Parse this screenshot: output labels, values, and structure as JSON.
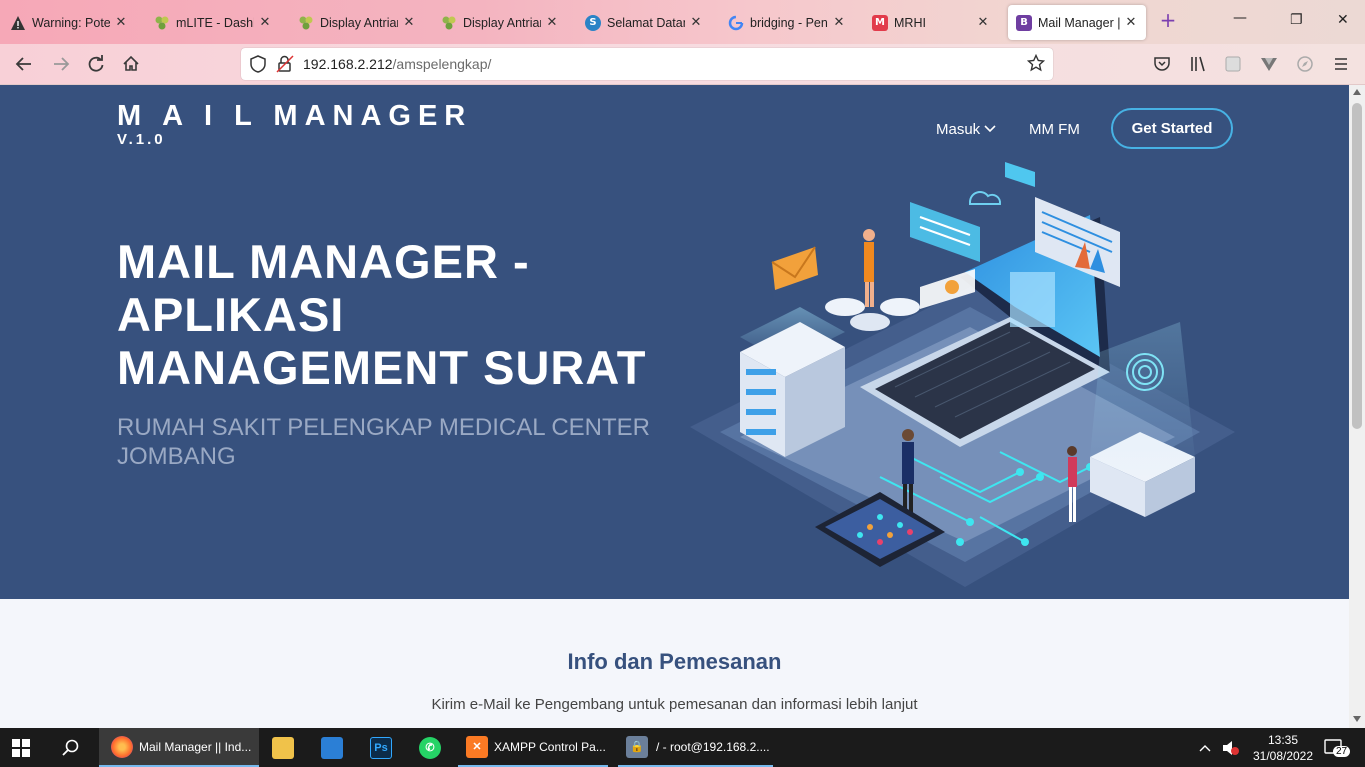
{
  "browser": {
    "tabs": [
      {
        "title": "Warning: Potent",
        "icon": "warning-icon"
      },
      {
        "title": "mLITE - Dashbo",
        "icon": "mlite-icon"
      },
      {
        "title": "Display Antrian |",
        "icon": "mlite-icon"
      },
      {
        "title": "Display Antrian |",
        "icon": "mlite-icon"
      },
      {
        "title": "Selamat Datang",
        "icon": "s-icon"
      },
      {
        "title": "bridging - Penel",
        "icon": "google-icon"
      },
      {
        "title": "MRHI",
        "icon": "mrhi-icon"
      },
      {
        "title": "Mail Manager ||",
        "icon": "bootstrap-icon"
      }
    ],
    "url_host": "192.168.2.212",
    "url_path": "/amspelengkap/"
  },
  "site": {
    "brand": "M A I L MANAGER",
    "version": "V.1.0",
    "nav": {
      "masuk": "Masuk",
      "mmfm": "MM FM",
      "get_started": "Get Started"
    },
    "hero_title": "MAIL MANAGER - APLIKASI MANAGEMENT SURAT",
    "hero_subtitle": "RUMAH SAKIT PELENGKAP MEDICAL CENTER JOMBANG",
    "section_title": "Info dan Pemesanan",
    "section_text": "Kirim e-Mail ke Pengembang untuk pemesanan dan informasi lebih lanjut"
  },
  "taskbar": {
    "items": [
      {
        "label": "Mail Manager || Ind...",
        "icon": "firefox-icon"
      },
      {
        "label": "XAMPP Control Pa...",
        "icon": "xampp-icon"
      },
      {
        "label": "/ - root@192.168.2....",
        "icon": "winscp-icon"
      }
    ],
    "time": "13:35",
    "date": "31/08/2022",
    "notifications": "27"
  },
  "colors": {
    "hero_bg": "#37517e",
    "accent": "#47b2e4"
  }
}
